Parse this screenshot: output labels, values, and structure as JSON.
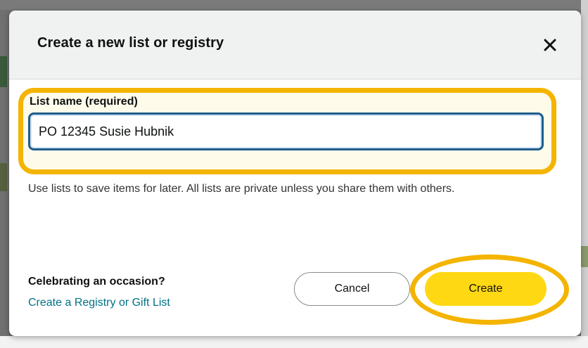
{
  "dialog": {
    "title": "Create a new list or registry",
    "close_icon": "close-icon"
  },
  "list_name": {
    "label": "List name (required)",
    "value": "PO 12345 Susie Hubnik"
  },
  "helper_text": "Use lists to save items for later. All lists are private unless you share them with others.",
  "occasion": {
    "title": "Celebrating an occasion?",
    "link_label": "Create a Registry or Gift List"
  },
  "actions": {
    "cancel_label": "Cancel",
    "create_label": "Create"
  },
  "colors": {
    "highlight": "#f4b400",
    "create_button": "#ffd814",
    "link": "#007185",
    "input_border": "#1f5d8c"
  }
}
